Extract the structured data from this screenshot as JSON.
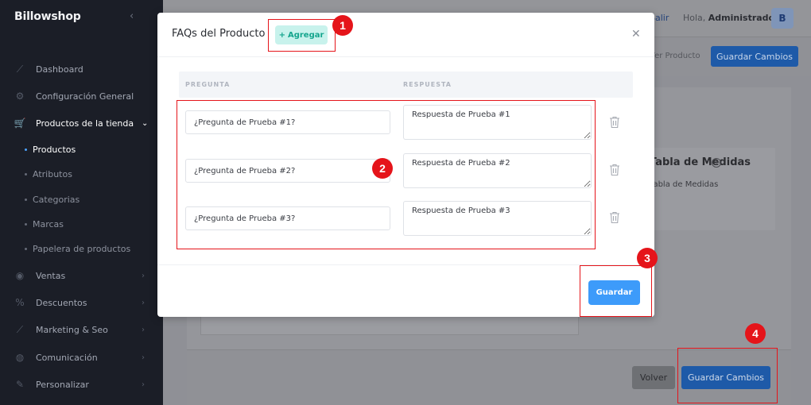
{
  "sidebar": {
    "brand": "Billowshop",
    "items": [
      {
        "label": "Dashboard",
        "icon": "chart-icon"
      },
      {
        "label": "Configuración General",
        "icon": "gear-icon"
      },
      {
        "label": "Productos de la tienda",
        "icon": "cart-icon"
      },
      {
        "label": "Ventas",
        "icon": "money-icon"
      },
      {
        "label": "Descuentos",
        "icon": "percent-icon"
      },
      {
        "label": "Marketing & Seo",
        "icon": "chart-icon"
      },
      {
        "label": "Comunicación",
        "icon": "globe-icon"
      },
      {
        "label": "Personalizar",
        "icon": "brush-icon"
      }
    ],
    "subitems": [
      "Productos",
      "Atributos",
      "Categorias",
      "Marcas",
      "Papelera de productos"
    ]
  },
  "topbar": {
    "salir": "Salir",
    "hello_prefix": "Hola, ",
    "hello_user": "Administrador",
    "avatar": "B"
  },
  "actionbar": {
    "ver_producto": "Ver Producto",
    "save_label": "Guardar Cambios"
  },
  "background": {
    "medidas_title": "Tabla de Medidas",
    "medidas_sub": "Tabla de Medidas"
  },
  "footer": {
    "back_label": "Volver",
    "save_label": "Guardar Cambios"
  },
  "modal": {
    "title": "FAQs del Producto",
    "add_label": "Agregar",
    "columns": [
      "PREGUNTA",
      "RESPUESTA"
    ],
    "rows": [
      {
        "question": "¿Pregunta de Prueba #1?",
        "answer": "Respuesta de Prueba #1"
      },
      {
        "question": "¿Pregunta de Prueba #2?",
        "answer": "Respuesta de Prueba #2"
      },
      {
        "question": "¿Pregunta de Prueba #3?",
        "answer": "Respuesta de Prueba #3"
      }
    ],
    "save_label": "Guardar"
  },
  "annotations": [
    "1",
    "2",
    "3",
    "4"
  ],
  "colors": {
    "annotation": "#e5141a",
    "primary": "#3d9bfa",
    "add_bg": "#c8f2ec",
    "add_fg": "#14a58d",
    "sidebar_bg": "#1b1e27"
  }
}
